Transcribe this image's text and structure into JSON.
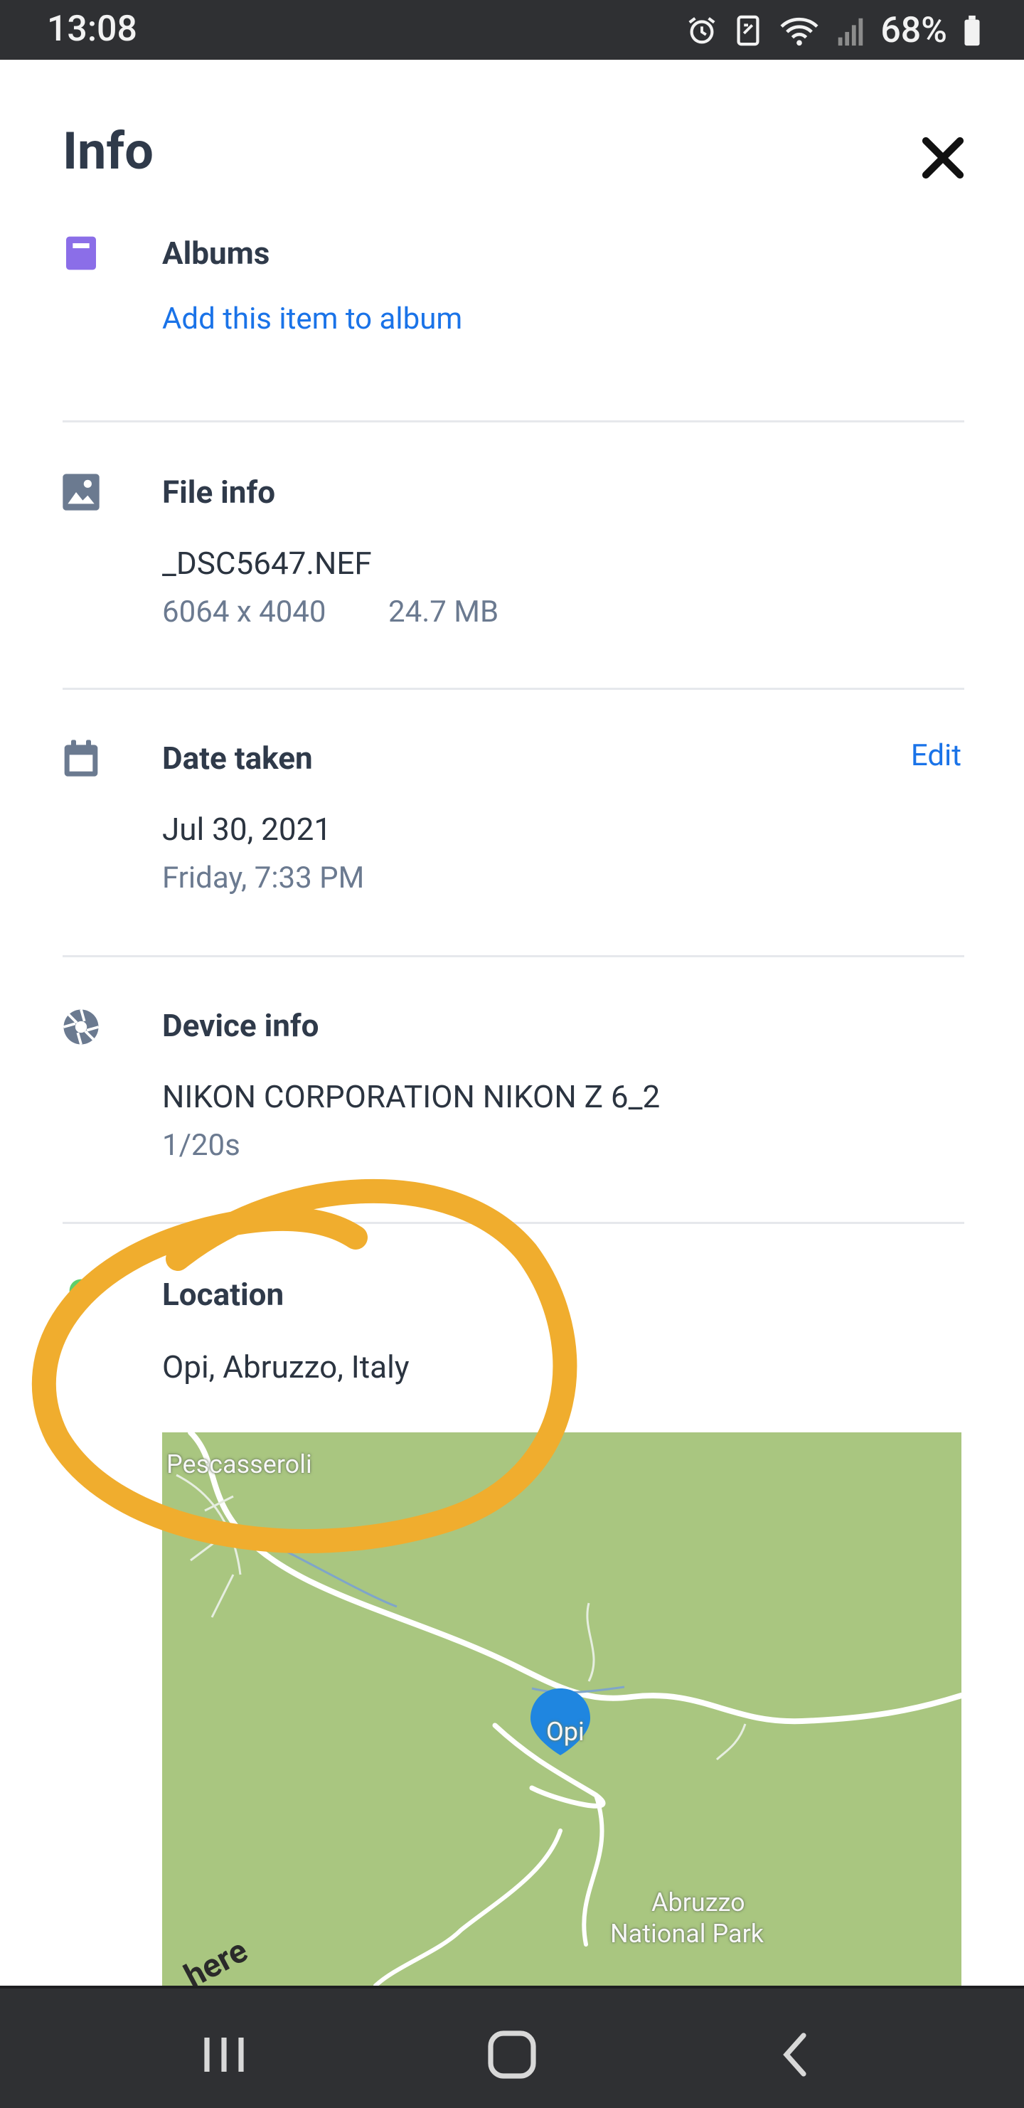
{
  "status_bar": {
    "time": "13:08",
    "battery": "68%"
  },
  "header": {
    "title": "Info"
  },
  "albums": {
    "title": "Albums",
    "link": "Add this item to album"
  },
  "file_info": {
    "title": "File info",
    "filename": "_DSC5647.NEF",
    "dimensions": "6064 x 4040",
    "size": "24.7 MB"
  },
  "date_taken": {
    "title": "Date taken",
    "date": "Jul 30, 2021",
    "weekday_time": "Friday, 7:33 PM",
    "edit_label": "Edit"
  },
  "device_info": {
    "title": "Device info",
    "device": "NIKON CORPORATION NIKON Z 6_2",
    "exposure": "1/20s"
  },
  "location": {
    "title": "Location",
    "place": "Opi, Abruzzo, Italy",
    "map_labels": {
      "town_1": "Pescasseroli",
      "town_2": "Opi",
      "park_line1": "Abruzzo",
      "park_line2": "National Park",
      "provider": "here"
    }
  },
  "icons": {
    "album": "album-icon",
    "file": "image-icon",
    "date": "calendar-icon",
    "device": "aperture-icon",
    "location": "location-pin-icon",
    "close": "close-icon"
  },
  "colors": {
    "accent": "#1a73e8",
    "album_icon": "#8b6ee8",
    "location_icon": "#5fcf6a",
    "annotation": "#f0ad2e",
    "map_bg": "#a9c680",
    "marker": "#1f86e0"
  }
}
